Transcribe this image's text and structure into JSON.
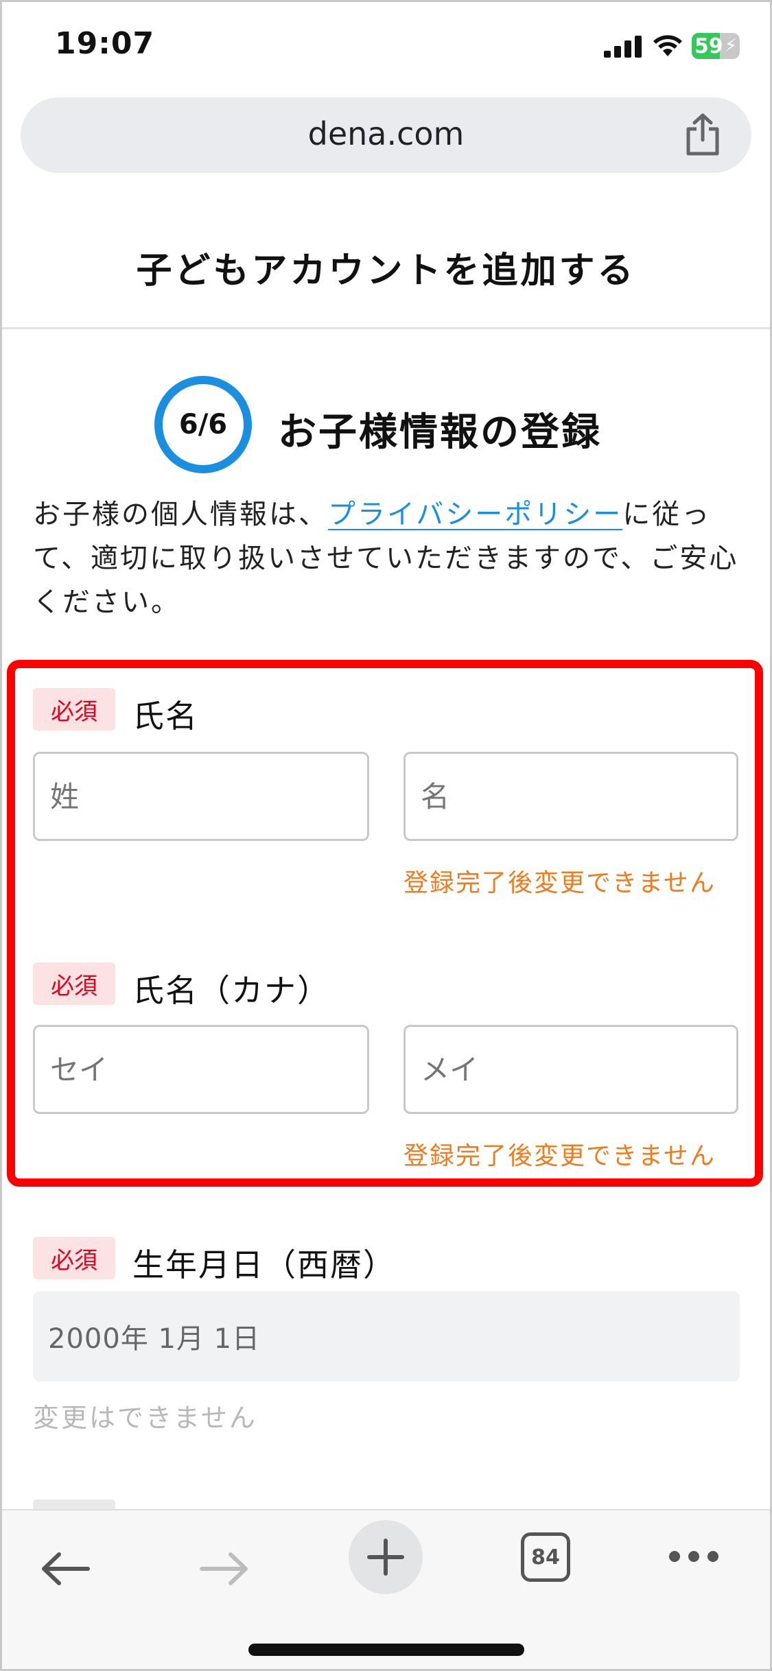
{
  "status_bar": {
    "time": "19:07",
    "battery_percent": "59",
    "battery_level": 0.59,
    "icons": [
      "cellular-signal-icon",
      "wifi-icon",
      "battery-charging-icon"
    ]
  },
  "browser": {
    "url": "dena.com",
    "share_icon": "share-icon"
  },
  "page": {
    "title": "子どもアカウントを追加する",
    "step": "6/6",
    "section_title": "お子様情報の登録",
    "intro_before_link": "お子様の個人情報は、",
    "intro_link": "プライバシーポリシー",
    "intro_after_link": "に従って、適切に取り扱いさせていただきますので、ご安心ください。"
  },
  "form": {
    "required_label": "必須",
    "name": {
      "label": "氏名",
      "last_placeholder": "姓",
      "first_placeholder": "名",
      "note": "登録完了後変更できません"
    },
    "kana": {
      "label": "氏名（カナ）",
      "last_placeholder": "セイ",
      "first_placeholder": "メイ",
      "note": "登録完了後変更できません"
    },
    "birthdate": {
      "label": "生年月日（西暦）",
      "value": "2000年 1月 1日",
      "note": "変更はできません"
    }
  },
  "toolbar": {
    "tab_count": "84",
    "icons": [
      "back-arrow-icon",
      "forward-arrow-icon",
      "plus-icon",
      "tabs-icon",
      "more-icon"
    ]
  },
  "colors": {
    "accent_blue": "#1a8fe0",
    "highlight_red": "#ff0000",
    "required_red": "#e8001c",
    "required_bg": "#fde2e3",
    "note_orange": "#f07a1c"
  }
}
